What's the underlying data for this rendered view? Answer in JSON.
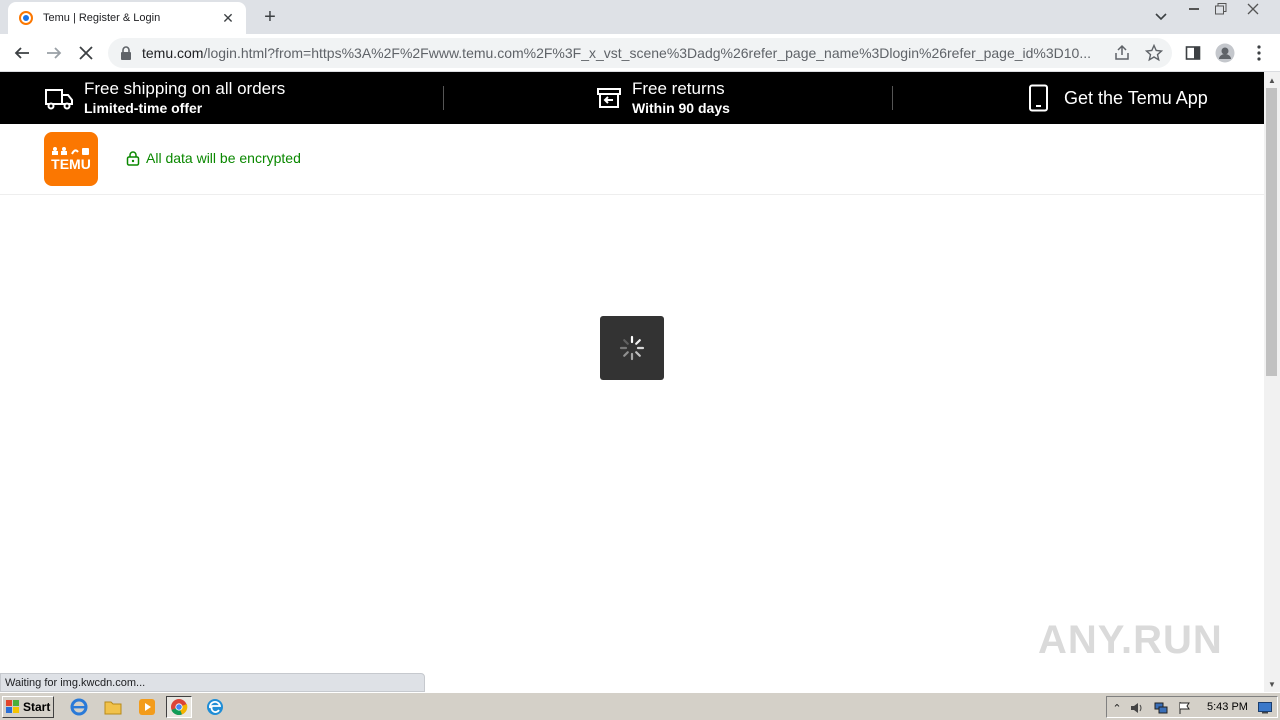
{
  "browser": {
    "tab_title": "Temu | Register & Login",
    "url_host": "temu.com",
    "url_rest": "/login.html?from=https%3A%2F%2Fwww.temu.com%2F%3F_x_vst_scene%3Dadg%26refer_page_name%3Dlogin%26refer_page_id%3D10...",
    "status_text": "Waiting for img.kwcdn.com..."
  },
  "promo": {
    "shipping_title": "Free shipping on all orders",
    "shipping_sub": "Limited-time offer",
    "returns_title": "Free returns",
    "returns_sub": "Within 90 days",
    "app_label": "Get the Temu App"
  },
  "header": {
    "logo_word": "TEMU",
    "encrypt_text": "All data will be encrypted"
  },
  "watermark": "ANY.RUN",
  "taskbar": {
    "start_label": "Start",
    "clock": "5:43 PM"
  },
  "colors": {
    "brand": "#fb7701",
    "secure_green": "#0a8800",
    "promo_bg": "#000000"
  }
}
